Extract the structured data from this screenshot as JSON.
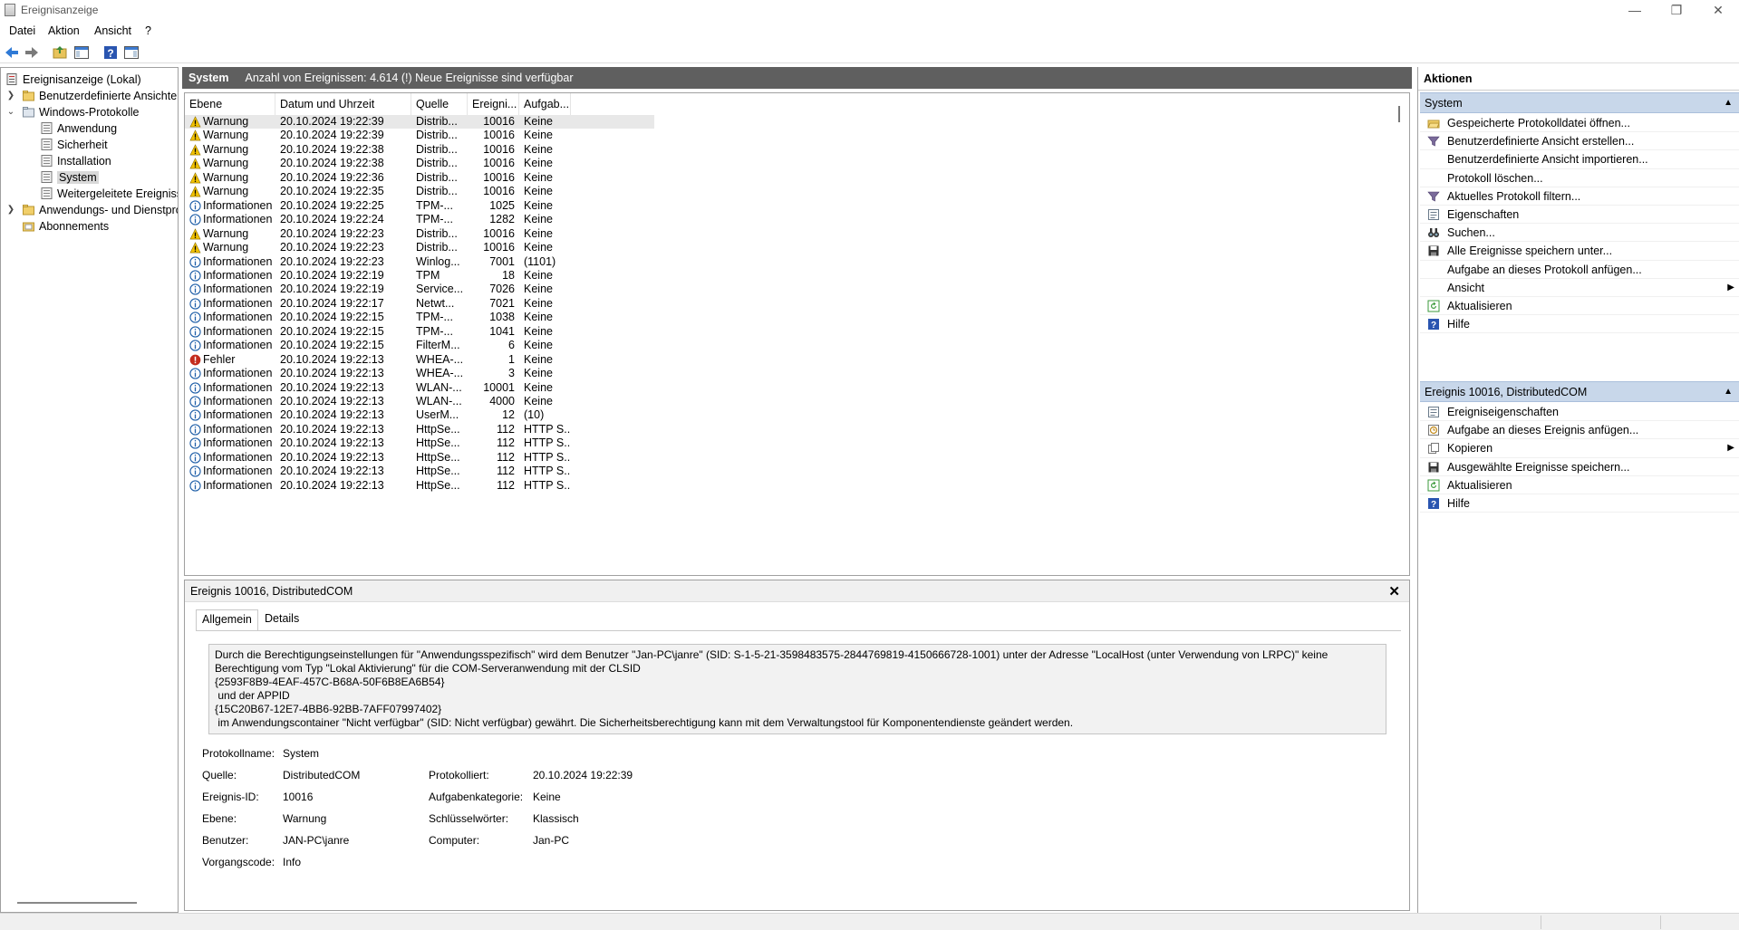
{
  "window": {
    "title": "Ereignisanzeige",
    "minimize_icon": "minimize-icon",
    "maximize_icon": "restore-icon",
    "close_icon": "close-icon"
  },
  "menu": [
    "Datei",
    "Aktion",
    "Ansicht",
    "?"
  ],
  "toolbar": {
    "icons": [
      "back-arrow-icon",
      "forward-arrow-icon",
      "folder-up-icon",
      "show-hide-tree-icon",
      "help-icon",
      "show-hide-action-pane-icon"
    ]
  },
  "tree": {
    "root": "Ereignisanzeige (Lokal)",
    "custom_views": "Benutzerdefinierte Ansichten",
    "windows_logs": "Windows-Protokolle",
    "logs": [
      "Anwendung",
      "Sicherheit",
      "Installation",
      "System",
      "Weitergeleitete Ereignisse"
    ],
    "app_services": "Anwendungs- und Dienstprotokolle",
    "subscriptions": "Abonnements",
    "selected": "System"
  },
  "log_header": {
    "name": "System",
    "info": "Anzahl von Ereignissen: 4.614 (!) Neue Ereignisse sind verfügbar"
  },
  "columns": [
    "Ebene",
    "Datum und Uhrzeit",
    "Quelle",
    "Ereigni...",
    "Aufgab..."
  ],
  "events": [
    {
      "level": "Warnung",
      "type": "warning",
      "date": "20.10.2024 19:22:39",
      "source": "Distrib...",
      "id": "10016",
      "task": "Keine",
      "selected": true
    },
    {
      "level": "Warnung",
      "type": "warning",
      "date": "20.10.2024 19:22:39",
      "source": "Distrib...",
      "id": "10016",
      "task": "Keine"
    },
    {
      "level": "Warnung",
      "type": "warning",
      "date": "20.10.2024 19:22:38",
      "source": "Distrib...",
      "id": "10016",
      "task": "Keine"
    },
    {
      "level": "Warnung",
      "type": "warning",
      "date": "20.10.2024 19:22:38",
      "source": "Distrib...",
      "id": "10016",
      "task": "Keine"
    },
    {
      "level": "Warnung",
      "type": "warning",
      "date": "20.10.2024 19:22:36",
      "source": "Distrib...",
      "id": "10016",
      "task": "Keine"
    },
    {
      "level": "Warnung",
      "type": "warning",
      "date": "20.10.2024 19:22:35",
      "source": "Distrib...",
      "id": "10016",
      "task": "Keine"
    },
    {
      "level": "Informationen",
      "type": "info",
      "date": "20.10.2024 19:22:25",
      "source": "TPM-...",
      "id": "1025",
      "task": "Keine"
    },
    {
      "level": "Informationen",
      "type": "info",
      "date": "20.10.2024 19:22:24",
      "source": "TPM-...",
      "id": "1282",
      "task": "Keine"
    },
    {
      "level": "Warnung",
      "type": "warning",
      "date": "20.10.2024 19:22:23",
      "source": "Distrib...",
      "id": "10016",
      "task": "Keine"
    },
    {
      "level": "Warnung",
      "type": "warning",
      "date": "20.10.2024 19:22:23",
      "source": "Distrib...",
      "id": "10016",
      "task": "Keine"
    },
    {
      "level": "Informationen",
      "type": "info",
      "date": "20.10.2024 19:22:23",
      "source": "Winlog...",
      "id": "7001",
      "task": "(1101)"
    },
    {
      "level": "Informationen",
      "type": "info",
      "date": "20.10.2024 19:22:19",
      "source": "TPM",
      "id": "18",
      "task": "Keine"
    },
    {
      "level": "Informationen",
      "type": "info",
      "date": "20.10.2024 19:22:19",
      "source": "Service...",
      "id": "7026",
      "task": "Keine"
    },
    {
      "level": "Informationen",
      "type": "info",
      "date": "20.10.2024 19:22:17",
      "source": "Netwt...",
      "id": "7021",
      "task": "Keine"
    },
    {
      "level": "Informationen",
      "type": "info",
      "date": "20.10.2024 19:22:15",
      "source": "TPM-...",
      "id": "1038",
      "task": "Keine"
    },
    {
      "level": "Informationen",
      "type": "info",
      "date": "20.10.2024 19:22:15",
      "source": "TPM-...",
      "id": "1041",
      "task": "Keine"
    },
    {
      "level": "Informationen",
      "type": "info",
      "date": "20.10.2024 19:22:15",
      "source": "FilterM...",
      "id": "6",
      "task": "Keine"
    },
    {
      "level": "Fehler",
      "type": "error",
      "date": "20.10.2024 19:22:13",
      "source": "WHEA-...",
      "id": "1",
      "task": "Keine"
    },
    {
      "level": "Informationen",
      "type": "info",
      "date": "20.10.2024 19:22:13",
      "source": "WHEA-...",
      "id": "3",
      "task": "Keine"
    },
    {
      "level": "Informationen",
      "type": "info",
      "date": "20.10.2024 19:22:13",
      "source": "WLAN-...",
      "id": "10001",
      "task": "Keine"
    },
    {
      "level": "Informationen",
      "type": "info",
      "date": "20.10.2024 19:22:13",
      "source": "WLAN-...",
      "id": "4000",
      "task": "Keine"
    },
    {
      "level": "Informationen",
      "type": "info",
      "date": "20.10.2024 19:22:13",
      "source": "UserM...",
      "id": "12",
      "task": "(10)"
    },
    {
      "level": "Informationen",
      "type": "info",
      "date": "20.10.2024 19:22:13",
      "source": "HttpSe...",
      "id": "112",
      "task": "HTTP S..."
    },
    {
      "level": "Informationen",
      "type": "info",
      "date": "20.10.2024 19:22:13",
      "source": "HttpSe...",
      "id": "112",
      "task": "HTTP S..."
    },
    {
      "level": "Informationen",
      "type": "info",
      "date": "20.10.2024 19:22:13",
      "source": "HttpSe...",
      "id": "112",
      "task": "HTTP S..."
    },
    {
      "level": "Informationen",
      "type": "info",
      "date": "20.10.2024 19:22:13",
      "source": "HttpSe...",
      "id": "112",
      "task": "HTTP S..."
    },
    {
      "level": "Informationen",
      "type": "info",
      "date": "20.10.2024 19:22:13",
      "source": "HttpSe...",
      "id": "112",
      "task": "HTTP S..."
    }
  ],
  "detail": {
    "title": "Ereignis 10016, DistributedCOM",
    "tabs": [
      "Allgemein",
      "Details"
    ],
    "description": "Durch die Berechtigungseinstellungen für \"Anwendungsspezifisch\" wird dem Benutzer \"Jan-PC\\janre\" (SID: S-1-5-21-3598483575-2844769819-4150666728-1001) unter der Adresse \"LocalHost (unter Verwendung von LRPC)\" keine Berechtigung vom Typ \"Lokal Aktivierung\" für die COM-Serveranwendung mit der CLSID \n{2593F8B9-4EAF-457C-B68A-50F6B8EA6B54}\n und der APPID \n{15C20B67-12E7-4BB6-92BB-7AFF07997402}\n im Anwendungscontainer \"Nicht verfügbar\" (SID: Nicht verfügbar) gewährt. Die Sicherheitsberechtigung kann mit dem Verwaltungstool für Komponentendienste geändert werden.",
    "props": {
      "logname_label": "Protokollname:",
      "logname": "System",
      "source_label": "Quelle:",
      "source": "DistributedCOM",
      "logged_label": "Protokolliert:",
      "logged": "20.10.2024 19:22:39",
      "eventid_label": "Ereignis-ID:",
      "eventid": "10016",
      "taskcat_label": "Aufgabenkategorie:",
      "taskcat": "Keine",
      "level_label": "Ebene:",
      "level": "Warnung",
      "keywords_label": "Schlüsselwörter:",
      "keywords": "Klassisch",
      "user_label": "Benutzer:",
      "user": "JAN-PC\\janre",
      "computer_label": "Computer:",
      "computer": "Jan-PC",
      "opcode_label": "Vorgangscode:",
      "opcode": "Info"
    }
  },
  "actions": {
    "title": "Aktionen",
    "section1": "System",
    "items1": [
      {
        "label": "Gespeicherte Protokolldatei öffnen...",
        "icon": "open-folder-icon"
      },
      {
        "label": "Benutzerdefinierte Ansicht erstellen...",
        "icon": "filter-icon"
      },
      {
        "label": "Benutzerdefinierte Ansicht importieren...",
        "icon": ""
      },
      {
        "label": "Protokoll löschen...",
        "icon": ""
      },
      {
        "label": "Aktuelles Protokoll filtern...",
        "icon": "filter-icon"
      },
      {
        "label": "Eigenschaften",
        "icon": "properties-icon"
      },
      {
        "label": "Suchen...",
        "icon": "binoculars-icon"
      },
      {
        "label": "Alle Ereignisse speichern unter...",
        "icon": "save-icon"
      },
      {
        "label": "Aufgabe an dieses Protokoll anfügen...",
        "icon": ""
      },
      {
        "label": "Ansicht",
        "icon": "",
        "submenu": true
      },
      {
        "label": "Aktualisieren",
        "icon": "refresh-icon"
      },
      {
        "label": "Hilfe",
        "icon": "help-icon"
      }
    ],
    "section2": "Ereignis 10016, DistributedCOM",
    "items2": [
      {
        "label": "Ereigniseigenschaften",
        "icon": "properties-icon"
      },
      {
        "label": "Aufgabe an dieses Ereignis anfügen...",
        "icon": "task-icon"
      },
      {
        "label": "Kopieren",
        "icon": "copy-icon",
        "submenu": true
      },
      {
        "label": "Ausgewählte Ereignisse speichern...",
        "icon": "save-icon"
      },
      {
        "label": "Aktualisieren",
        "icon": "refresh-icon"
      },
      {
        "label": "Hilfe",
        "icon": "help-icon"
      }
    ]
  },
  "colors": {
    "header_bg": "#5f5f5f",
    "section_bg": "#c8d7ea",
    "warning": "#f2c200",
    "info": "#1f5fa8",
    "error": "#c42b1c"
  }
}
